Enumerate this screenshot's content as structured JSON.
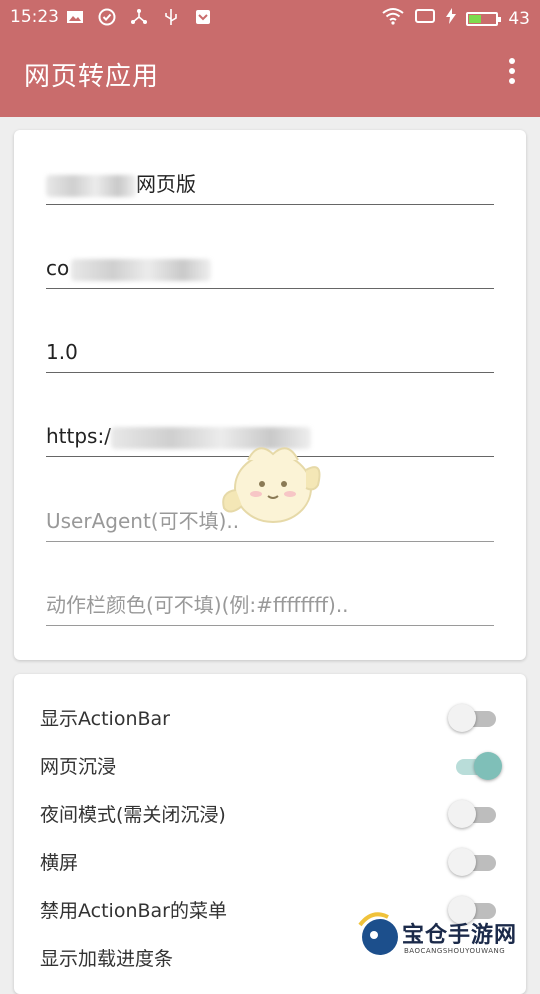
{
  "status_bar": {
    "time": "15:23",
    "battery_level": "43",
    "battery_fraction": 0.43,
    "battery_color": "#7ddb4e",
    "icons": [
      "image-icon",
      "check-circle-icon",
      "share-icon",
      "usb-icon",
      "download-shield-icon",
      "wifi-icon",
      "screen-icon",
      "charging-bolt-icon",
      "battery-icon"
    ]
  },
  "toolbar": {
    "title": "网页转应用",
    "background": "#c96c6c",
    "menu_icon": "more-vert-icon"
  },
  "form": {
    "app_name_suffix": "网页版",
    "package_prefix": "co",
    "version": "1.0",
    "url_prefix": "https:/",
    "useragent_placeholder": "UserAgent(可不填)..",
    "actionbar_color_placeholder": "动作栏颜色(可不填)(例:#ffffffff).."
  },
  "switches": [
    {
      "label": "显示ActionBar",
      "on": false
    },
    {
      "label": "网页沉浸",
      "on": true
    },
    {
      "label": "夜间模式(需关闭沉浸)",
      "on": false
    },
    {
      "label": "横屏",
      "on": false
    },
    {
      "label": "禁用ActionBar的菜单",
      "on": false
    },
    {
      "label": "显示加载进度条",
      "on": false
    }
  ],
  "watermark": {
    "text": "宝仓手游网",
    "sub": "BAOCANGSHOUYOUWANG"
  },
  "colors": {
    "accent_on": "#7fbfb8",
    "toolbar": "#c96c6c"
  }
}
